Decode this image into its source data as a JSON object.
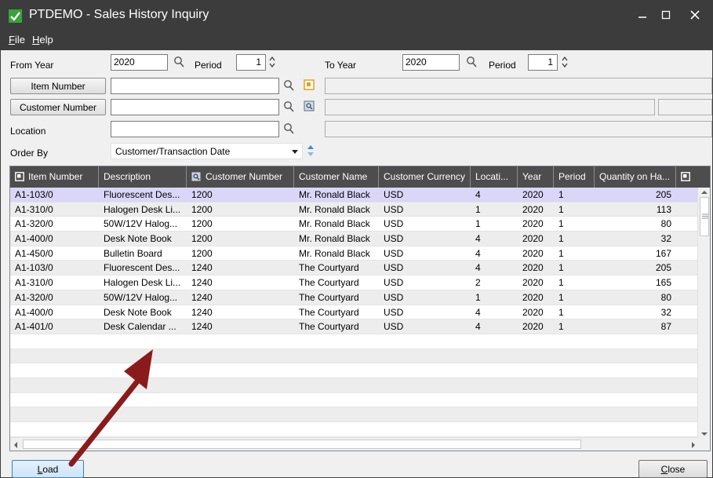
{
  "window": {
    "title": "PTDEMO - Sales History Inquiry",
    "minimize_icon": "minimize-icon",
    "maximize_icon": "maximize-icon",
    "close_icon": "close-icon"
  },
  "menu": {
    "items": [
      {
        "label": "File",
        "accel": "F",
        "rest": "ile"
      },
      {
        "label": "Help",
        "accel": "H",
        "rest": "elp"
      }
    ]
  },
  "filters": {
    "from_year_label": "From Year",
    "from_year_value": "2020",
    "period_label": "Period",
    "from_period_value": "1",
    "to_year_label": "To Year",
    "to_year_value": "2020",
    "to_period_label": "Period",
    "to_period_value": "1",
    "item_number_button": "Item Number",
    "item_number_value": "",
    "customer_number_button": "Customer Number",
    "customer_number_value": "",
    "location_label": "Location",
    "location_value": "",
    "order_by_label": "Order By",
    "order_by_value": "Customer/Transaction Date"
  },
  "grid": {
    "columns": [
      "Item Number",
      "Description",
      "Customer Number",
      "Customer Name",
      "Customer Currency",
      "Locati...",
      "Year",
      "Period",
      "Quantity on Ha..."
    ],
    "rows": [
      [
        "A1-103/0",
        "Fluorescent Des...",
        "1200",
        "Mr. Ronald Black",
        "USD",
        "4",
        "2020",
        "1",
        "205"
      ],
      [
        "A1-310/0",
        "Halogen Desk Li...",
        "1200",
        "Mr. Ronald Black",
        "USD",
        "1",
        "2020",
        "1",
        "113"
      ],
      [
        "A1-320/0",
        "50W/12V Halog...",
        "1200",
        "Mr. Ronald Black",
        "USD",
        "1",
        "2020",
        "1",
        "80"
      ],
      [
        "A1-400/0",
        "Desk Note Book",
        "1200",
        "Mr. Ronald Black",
        "USD",
        "4",
        "2020",
        "1",
        "32"
      ],
      [
        "A1-450/0",
        "Bulletin Board",
        "1200",
        "Mr. Ronald Black",
        "USD",
        "4",
        "2020",
        "1",
        "167"
      ],
      [
        "A1-103/0",
        "Fluorescent Des...",
        "1240",
        "The Courtyard",
        "USD",
        "4",
        "2020",
        "1",
        "205"
      ],
      [
        "A1-310/0",
        "Halogen Desk Li...",
        "1240",
        "The Courtyard",
        "USD",
        "2",
        "2020",
        "1",
        "165"
      ],
      [
        "A1-320/0",
        "50W/12V Halog...",
        "1240",
        "The Courtyard",
        "USD",
        "1",
        "2020",
        "1",
        "80"
      ],
      [
        "A1-400/0",
        "Desk Note Book",
        "1240",
        "The Courtyard",
        "USD",
        "4",
        "2020",
        "1",
        "32"
      ],
      [
        "A1-401/0",
        "Desk Calendar ...",
        "1240",
        "The Courtyard",
        "USD",
        "4",
        "2020",
        "1",
        "87"
      ]
    ],
    "selected_row_color": "#d9d6f7",
    "header_color": "#4d4d4d"
  },
  "footer": {
    "load_button": "Load",
    "load_accel": "L",
    "load_rest": "oad",
    "close_button": "Close",
    "close_accel": "C",
    "close_rest": "lose"
  },
  "annotation": {
    "arrow_color": "#8b1a1a"
  }
}
